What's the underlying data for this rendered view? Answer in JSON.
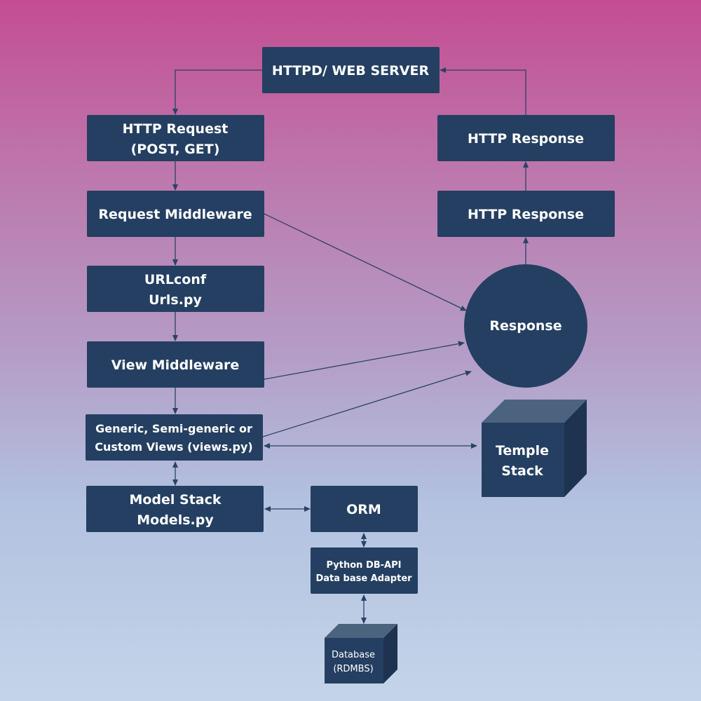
{
  "colors": {
    "box": "#243f61",
    "arrow": "#2a4264",
    "background_top": "#c44d92",
    "background_bottom": "#c4d4e8"
  },
  "nodes": {
    "web_server": "HTTPD/ WEB SERVER",
    "http_request": [
      "HTTP Request",
      "(POST, GET)"
    ],
    "request_middleware": "Request Middleware",
    "urlconf": [
      "URLconf",
      "Urls.py"
    ],
    "view_middleware": "View Middleware",
    "views": [
      "Generic, Semi-generic or",
      "Custom  Views (views.py)"
    ],
    "model_stack": [
      "Model Stack",
      "Models.py"
    ],
    "orm": "ORM",
    "db_api": [
      "Python DB-API",
      "Data base Adapter"
    ],
    "database": [
      "Database",
      "(RDMBS)"
    ],
    "http_response_top": "HTTP Response",
    "http_response_bottom": "HTTP Response",
    "response": "Response",
    "template_stack": [
      "Temple",
      "Stack"
    ]
  }
}
